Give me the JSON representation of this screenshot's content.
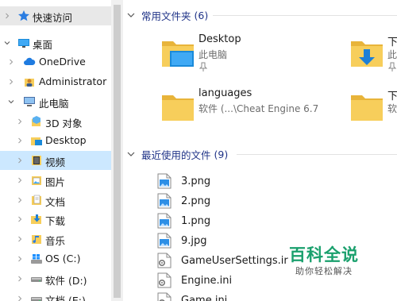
{
  "nav": {
    "items": [
      {
        "label": "快速访问",
        "icon": "star-icon",
        "level": 0,
        "expanded": false,
        "state": "hover"
      },
      {
        "label": "桌面",
        "icon": "desktop-icon",
        "level": 0,
        "expanded": true,
        "state": ""
      },
      {
        "label": "OneDrive",
        "icon": "cloud-icon",
        "level": 1,
        "expanded": false,
        "state": ""
      },
      {
        "label": "Administrator",
        "icon": "user-folder-icon",
        "level": 1,
        "expanded": false,
        "state": ""
      },
      {
        "label": "此电脑",
        "icon": "computer-icon",
        "level": 1,
        "expanded": true,
        "state": ""
      },
      {
        "label": "3D 对象",
        "icon": "3d-objects-icon",
        "level": 2,
        "expanded": false,
        "state": ""
      },
      {
        "label": "Desktop",
        "icon": "desktop-folder-icon",
        "level": 2,
        "expanded": false,
        "state": ""
      },
      {
        "label": "视频",
        "icon": "video-folder-icon",
        "level": 2,
        "expanded": false,
        "state": "selected"
      },
      {
        "label": "图片",
        "icon": "pictures-folder-icon",
        "level": 2,
        "expanded": false,
        "state": ""
      },
      {
        "label": "文档",
        "icon": "documents-folder-icon",
        "level": 2,
        "expanded": false,
        "state": ""
      },
      {
        "label": "下载",
        "icon": "downloads-folder-icon",
        "level": 2,
        "expanded": false,
        "state": ""
      },
      {
        "label": "音乐",
        "icon": "music-folder-icon",
        "level": 2,
        "expanded": false,
        "state": ""
      },
      {
        "label": "OS (C:)",
        "icon": "windows-drive-icon",
        "level": 2,
        "expanded": false,
        "state": ""
      },
      {
        "label": "软件 (D:)",
        "icon": "drive-icon",
        "level": 2,
        "expanded": false,
        "state": ""
      },
      {
        "label": "文档 (E:)",
        "icon": "drive-icon",
        "level": 2,
        "expanded": false,
        "state": ""
      }
    ]
  },
  "frequent": {
    "title": "常用文件夹",
    "count": "(6)",
    "tiles": [
      {
        "name": "Desktop",
        "sub": "此电脑",
        "icon": "desktop-folder-icon"
      },
      {
        "name": "下载",
        "sub": "此电",
        "icon": "downloads-folder-icon"
      },
      {
        "name": "languages",
        "sub": "软件 (...\\Cheat Engine 6.7",
        "icon": "folder-icon"
      },
      {
        "name": "下载",
        "sub": "软件",
        "icon": "folder-icon"
      }
    ]
  },
  "recent": {
    "title": "最近使用的文件",
    "count": "(9)",
    "files": [
      {
        "name": "3.png",
        "icon": "image-file-icon"
      },
      {
        "name": "2.png",
        "icon": "image-file-icon"
      },
      {
        "name": "1.png",
        "icon": "image-file-icon"
      },
      {
        "name": "9.jpg",
        "icon": "image-file-icon"
      },
      {
        "name": "GameUserSettings.ir",
        "icon": "settings-file-icon"
      },
      {
        "name": "Engine.ini",
        "icon": "settings-file-icon"
      },
      {
        "name": "Game.ini",
        "icon": "settings-file-icon"
      }
    ]
  },
  "watermark": {
    "title": "百科全说",
    "subtitle": "助你轻松解决"
  },
  "colors": {
    "accent": "#1e3287",
    "selected": "#cce8ff",
    "folder": "#f7ce5b",
    "watermark": "#1aa06d"
  }
}
